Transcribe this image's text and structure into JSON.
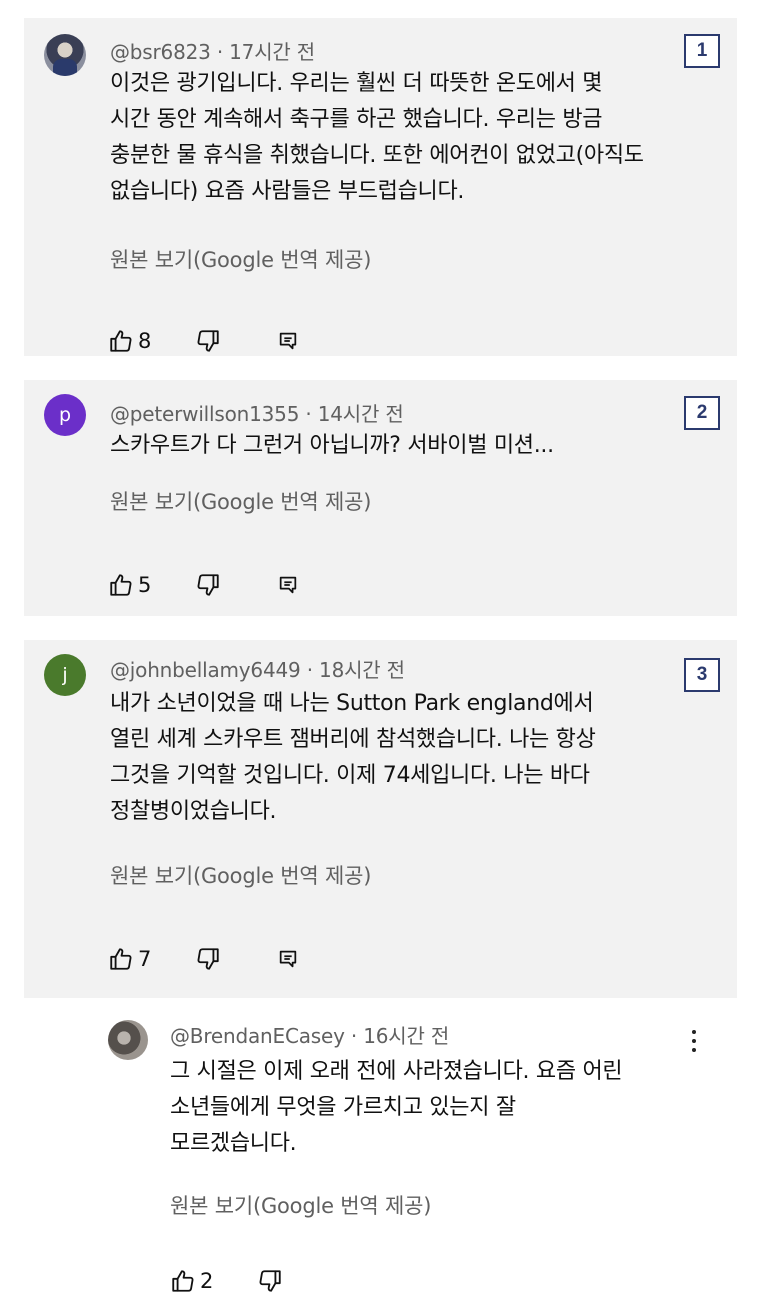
{
  "comments": [
    {
      "badge": "1",
      "author": "@bsr6823",
      "time": "17시간 전",
      "lines": [
        "이것은 광기입니다. 우리는 훨씬 더 따뜻한 온도에서 몇",
        "시간 동안 계속해서 축구를 하곤 했습니다. 우리는 방금",
        "충분한 물 휴식을 취했습니다. 또한 에어컨이 없었고(아직도",
        "없습니다) 요즘 사람들은 부드럽습니다."
      ],
      "translate_label": "원본 보기(Google 번역 제공)",
      "likes": "8"
    },
    {
      "badge": "2",
      "avatar_letter": "p",
      "avatar_color": "#6b2fc9",
      "author": "@peterwillson1355",
      "time": "14시간 전",
      "lines": [
        "스카우트가 다 그런거 아닙니까? 서바이벌 미션..."
      ],
      "translate_label": "원본 보기(Google 번역 제공)",
      "likes": "5"
    },
    {
      "badge": "3",
      "avatar_letter": "j",
      "avatar_color": "#4a7a2c",
      "author": "@johnbellamy6449",
      "time": "18시간 전",
      "lines": [
        "내가 소년이었을 때 나는 Sutton Park england에서",
        "열린 세계 스카우트 잼버리에 참석했습니다. 나는 항상",
        "그것을 기억할 것입니다. 이제 74세입니다. 나는 바다",
        "정찰병이었습니다."
      ],
      "translate_label": "원본 보기(Google 번역 제공)",
      "likes": "7"
    }
  ],
  "reply": {
    "author": "@BrendanECasey",
    "time": "16시간 전",
    "lines": [
      "그 시절은 이제 오래 전에 사라졌습니다. 요즘 어린",
      "소년들에게 무엇을 가르치고 있는지 잘",
      "모르겠습니다."
    ],
    "translate_label": "원본 보기(Google 번역 제공)",
    "likes": "2"
  },
  "separator": "·",
  "icons": {
    "like": "thumbs-up-icon",
    "dislike": "thumbs-down-icon",
    "reply": "reply-icon",
    "more": "more-vertical-icon"
  },
  "colors": {
    "card_bg": "#f2f2f2",
    "badge_border": "#2b3a6e",
    "meta_text": "#606060"
  }
}
